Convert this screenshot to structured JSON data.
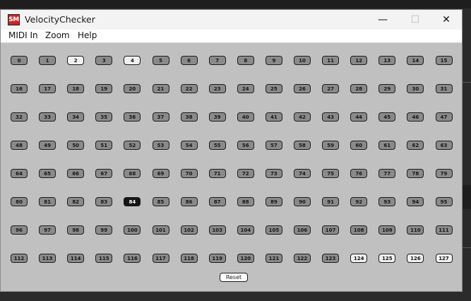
{
  "window": {
    "title": "VelocityChecker",
    "app_icon_text": "SM",
    "controls": {
      "minimize": "—",
      "maximize": "☐",
      "close": "✕"
    }
  },
  "menu": [
    {
      "label": "MIDI In"
    },
    {
      "label": "Zoom"
    },
    {
      "label": "Help"
    }
  ],
  "grid": {
    "values": [
      "0",
      "1",
      "2",
      "3",
      "4",
      "5",
      "6",
      "7",
      "8",
      "9",
      "10",
      "11",
      "12",
      "13",
      "14",
      "15",
      "16",
      "17",
      "18",
      "19",
      "20",
      "21",
      "22",
      "23",
      "24",
      "25",
      "26",
      "27",
      "28",
      "29",
      "30",
      "31",
      "32",
      "33",
      "34",
      "35",
      "36",
      "37",
      "38",
      "39",
      "40",
      "41",
      "42",
      "43",
      "44",
      "45",
      "46",
      "47",
      "48",
      "49",
      "50",
      "51",
      "52",
      "53",
      "54",
      "55",
      "56",
      "57",
      "58",
      "59",
      "60",
      "61",
      "62",
      "63",
      "64",
      "65",
      "66",
      "67",
      "68",
      "69",
      "70",
      "71",
      "72",
      "73",
      "74",
      "75",
      "76",
      "77",
      "78",
      "79",
      "80",
      "81",
      "82",
      "83",
      "84",
      "85",
      "86",
      "87",
      "88",
      "89",
      "90",
      "91",
      "92",
      "93",
      "94",
      "95",
      "96",
      "97",
      "98",
      "99",
      "100",
      "101",
      "102",
      "103",
      "104",
      "105",
      "106",
      "107",
      "108",
      "109",
      "110",
      "111",
      "112",
      "113",
      "114",
      "115",
      "116",
      "117",
      "118",
      "119",
      "120",
      "121",
      "122",
      "123",
      "124",
      "125",
      "126",
      "127"
    ],
    "outlined": [
      "2",
      "4",
      "124",
      "125",
      "126",
      "127"
    ],
    "active": [
      "84"
    ]
  },
  "reset_label": "Reset",
  "colors": {
    "client_bg": "#c0c0c0",
    "button_gray": "#8a8a8a",
    "button_outlined": "#f0f0f0",
    "button_active": "#151515"
  }
}
